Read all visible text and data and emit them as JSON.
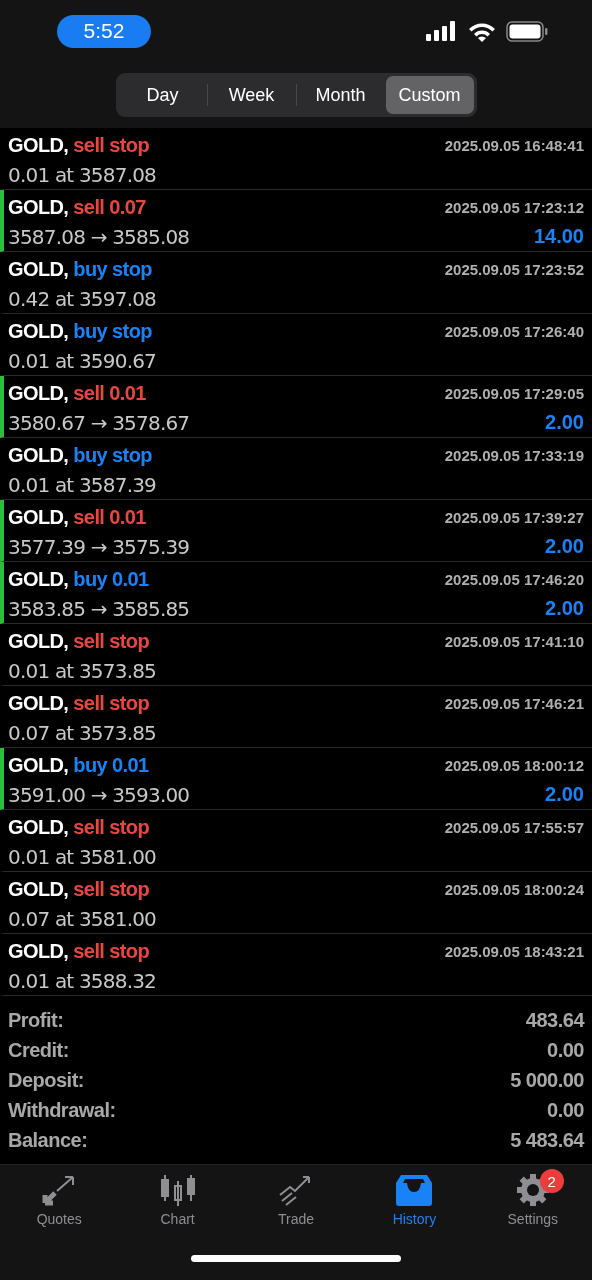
{
  "status_bar": {
    "time": "5:52"
  },
  "periods": [
    {
      "label": "Day",
      "selected": false
    },
    {
      "label": "Week",
      "selected": false
    },
    {
      "label": "Month",
      "selected": false
    },
    {
      "label": "Custom",
      "selected": true
    }
  ],
  "history": [
    {
      "kind": "order",
      "symbol": "GOLD,",
      "color": "#e8463f",
      "action": "sell stop",
      "detail": "0.01 at 3587.08",
      "time": "2025.09.05 16:48:41"
    },
    {
      "kind": "deal",
      "symbol": "GOLD,",
      "color": "#e8463f",
      "action": "sell 0.07",
      "detail": "3587.08 → 3585.08",
      "time": "2025.09.05 17:23:12",
      "profit": "14.00"
    },
    {
      "kind": "order",
      "symbol": "GOLD,",
      "color": "#1a82f7",
      "action": "buy stop",
      "detail": "0.42 at 3597.08",
      "time": "2025.09.05 17:23:52"
    },
    {
      "kind": "order",
      "symbol": "GOLD,",
      "color": "#1a82f7",
      "action": "buy stop",
      "detail": "0.01 at 3590.67",
      "time": "2025.09.05 17:26:40"
    },
    {
      "kind": "deal",
      "symbol": "GOLD,",
      "color": "#e8463f",
      "action": "sell 0.01",
      "detail": "3580.67 → 3578.67",
      "time": "2025.09.05 17:29:05",
      "profit": "2.00"
    },
    {
      "kind": "order",
      "symbol": "GOLD,",
      "color": "#1a82f7",
      "action": "buy stop",
      "detail": "0.01 at 3587.39",
      "time": "2025.09.05 17:33:19"
    },
    {
      "kind": "deal",
      "symbol": "GOLD,",
      "color": "#e8463f",
      "action": "sell 0.01",
      "detail": "3577.39 → 3575.39",
      "time": "2025.09.05 17:39:27",
      "profit": "2.00"
    },
    {
      "kind": "deal",
      "symbol": "GOLD,",
      "color": "#1a82f7",
      "action": "buy 0.01",
      "detail": "3583.85 → 3585.85",
      "time": "2025.09.05 17:46:20",
      "profit": "2.00"
    },
    {
      "kind": "order",
      "symbol": "GOLD,",
      "color": "#e8463f",
      "action": "sell stop",
      "detail": "0.01 at 3573.85",
      "time": "2025.09.05 17:41:10"
    },
    {
      "kind": "order",
      "symbol": "GOLD,",
      "color": "#e8463f",
      "action": "sell stop",
      "detail": "0.07 at 3573.85",
      "time": "2025.09.05 17:46:21"
    },
    {
      "kind": "deal",
      "symbol": "GOLD,",
      "color": "#1a82f7",
      "action": "buy 0.01",
      "detail": "3591.00 → 3593.00",
      "time": "2025.09.05 18:00:12",
      "profit": "2.00"
    },
    {
      "kind": "order",
      "symbol": "GOLD,",
      "color": "#e8463f",
      "action": "sell stop",
      "detail": "0.01 at 3581.00",
      "time": "2025.09.05 17:55:57"
    },
    {
      "kind": "order",
      "symbol": "GOLD,",
      "color": "#e8463f",
      "action": "sell stop",
      "detail": "0.07 at 3581.00",
      "time": "2025.09.05 18:00:24"
    },
    {
      "kind": "order",
      "symbol": "GOLD,",
      "color": "#e8463f",
      "action": "sell stop",
      "detail": "0.01 at 3588.32",
      "time": "2025.09.05 18:43:21"
    }
  ],
  "summary": [
    {
      "label": "Profit:",
      "value": "483.64"
    },
    {
      "label": "Credit:",
      "value": "0.00"
    },
    {
      "label": "Deposit:",
      "value": "5 000.00"
    },
    {
      "label": "Withdrawal:",
      "value": "0.00"
    },
    {
      "label": "Balance:",
      "value": "5 483.64"
    }
  ],
  "tab_bar": [
    {
      "kind": "quotes",
      "label": "Quotes",
      "selected": false
    },
    {
      "kind": "chart",
      "label": "Chart",
      "selected": false
    },
    {
      "kind": "trade",
      "label": "Trade",
      "selected": false
    },
    {
      "kind": "history",
      "label": "History",
      "selected": true
    },
    {
      "kind": "settings",
      "label": "Settings",
      "selected": false,
      "badge": "2"
    }
  ]
}
